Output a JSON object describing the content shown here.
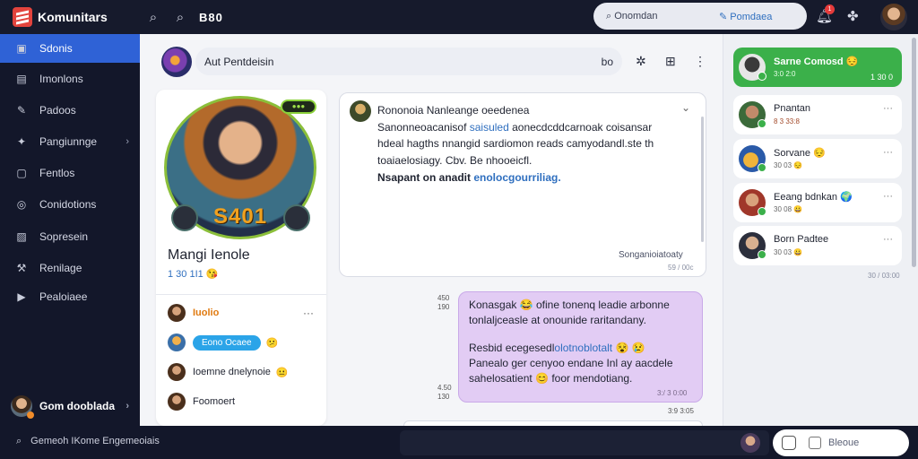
{
  "app": {
    "name": "Komunitars",
    "code": "B80"
  },
  "topbar": {
    "search_left": "Onomdan",
    "search_right": "Pomdaea",
    "notification_count": "1"
  },
  "sidebar": {
    "items": [
      {
        "label": "Sdonis",
        "icon": "inbox-icon"
      },
      {
        "label": "Imonlons",
        "icon": "image-icon"
      },
      {
        "label": "Padoos",
        "icon": "edit-icon"
      },
      {
        "label": "Pangiunnge",
        "icon": "users-icon"
      },
      {
        "label": "Fentlos",
        "icon": "folder-icon"
      },
      {
        "label": "Conidotions",
        "icon": "globe-icon"
      },
      {
        "label": "Sopresein",
        "icon": "photo-icon"
      },
      {
        "label": "Renilage",
        "icon": "tools-icon"
      },
      {
        "label": "Pealoiaee",
        "icon": "play-icon"
      }
    ],
    "user_label": "Gom dooblada"
  },
  "room": {
    "title": "Aut Pentdeisin",
    "action": "bo"
  },
  "profile": {
    "badge": "●●●",
    "score": "S401",
    "name": "Mangi Ienole",
    "stats": "1 30 1I1 😘",
    "friends": [
      {
        "name": "Iuolio",
        "emoji": ""
      },
      {
        "name": "Eono Ocaee",
        "emoji": "😕"
      },
      {
        "name": "Ioemne dnelynoie",
        "emoji": "😐"
      },
      {
        "name": "Foomoert",
        "emoji": ""
      }
    ]
  },
  "incoming": {
    "title": "Rononoia Nanleange oeedenea",
    "line1_a": "Sanonneoacanisof ",
    "line1_link": "saisuled",
    "line1_b": " aonecdcddcarnoak coisansar",
    "line2": "hdeal hagths nnangid sardiomon reads camyodandl.ste th",
    "line3": "toaiaelosiagy. Cbv. Be nhooeicfl.",
    "line4_a": "Nsapant on anadit ",
    "line4_link": "enolocgourriliag.",
    "footer": "Songanioiatoaty",
    "time": "59 / 00c"
  },
  "outgoing": {
    "meta1": "450",
    "meta2": "190",
    "meta3": "4.50",
    "meta4": "130",
    "line1": "Konasgak 😂 ofine tonenq leadie arbonne",
    "line2": "tonlaljceasle at onounide raritandany.",
    "line3_a": "Resbid ecegesedl",
    "line3_link": "olotnoblotalt",
    "line3_b": " 😵 😢",
    "line4": "Panealo ger cenyoo endane Inl ay aacdele",
    "line5": "sahelosatient 😊 foor mendotiang.",
    "time1": "3:/ 3 0:00",
    "time2": "3:9 3:05"
  },
  "chats": [
    {
      "name": "Sarne Comosd 😔",
      "sub": "3:0 2:0",
      "more": "1 30 0"
    },
    {
      "name": "Pnantan",
      "sub": "8 3 33:8",
      "more": "···"
    },
    {
      "name": "Sorvane 😔",
      "sub": "30 03 😔",
      "more": "···"
    },
    {
      "name": "Eeang bdnkan 🌍",
      "sub": "30 08 😀",
      "more": "···"
    },
    {
      "name": "Born Padtee",
      "sub": "30 03 😀",
      "more": "···"
    }
  ],
  "right_time": "30 / 03:00",
  "bottom": {
    "left_text": "Gemeoh IKome Engemeoiais",
    "compose_label": "Bleoue"
  }
}
